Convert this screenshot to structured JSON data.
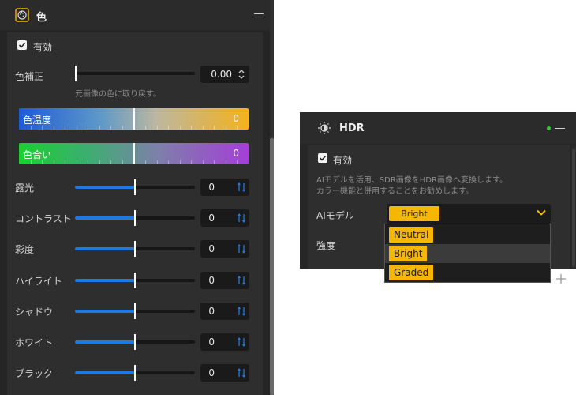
{
  "left_panel": {
    "title": "色",
    "icon": "palette-icon",
    "enabled_label": "有効",
    "enabled": true,
    "color_correction": {
      "label": "色補正",
      "value": "0.00",
      "fraction": 0.0,
      "hint": "元画像の色に取り戻す。"
    },
    "temperature": {
      "label": "色温度",
      "value": "0",
      "fraction": 0.5
    },
    "tint": {
      "label": "色合い",
      "value": "0",
      "fraction": 0.5
    },
    "sliders": [
      {
        "label": "露光",
        "value": "0",
        "fraction": 0.5
      },
      {
        "label": "コントラスト",
        "value": "0",
        "fraction": 0.5
      },
      {
        "label": "彩度",
        "value": "0",
        "fraction": 0.5
      },
      {
        "label": "ハイライト",
        "value": "0",
        "fraction": 0.5
      },
      {
        "label": "シャドウ",
        "value": "0",
        "fraction": 0.5
      },
      {
        "label": "ホワイト",
        "value": "0",
        "fraction": 0.5
      },
      {
        "label": "ブラック",
        "value": "0",
        "fraction": 0.5
      }
    ]
  },
  "right_panel": {
    "title": "HDR",
    "icon": "hdr-icon",
    "status": "active",
    "status_color": "#37c43a",
    "enabled_label": "有効",
    "enabled": true,
    "description_1": "AIモデルを活用、SDR画像をHDR画像へ変換します。",
    "description_2": "カラー機能と併用することをお勧めします。",
    "model_label": "AIモデル",
    "model_selected": "Bright",
    "intensity_label": "強度",
    "options": [
      "Neutral",
      "Bright",
      "Graded"
    ],
    "highlighted_option": 1
  },
  "colors": {
    "accent_blue": "#1e7ae0",
    "accent_yellow": "#f5b700",
    "panel_bg": "#2e2e2e"
  }
}
